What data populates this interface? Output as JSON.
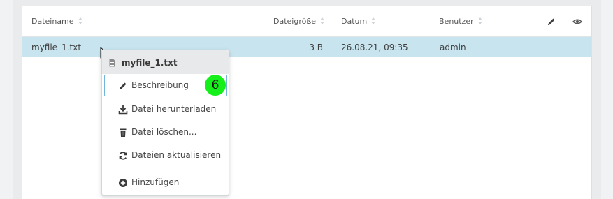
{
  "table": {
    "columns": {
      "filename": "Dateiname",
      "size": "Dateigröße",
      "date": "Datum",
      "user": "Benutzer"
    },
    "header_icons": [
      "pencil-icon",
      "eye-icon"
    ],
    "rows": [
      {
        "filename": "myfile_1.txt",
        "size": "3 B",
        "date": "26.08.21, 09:35",
        "user": "admin",
        "edit": "—",
        "view": "—"
      }
    ]
  },
  "context_menu": {
    "title": "myfile_1.txt",
    "title_icon": "file-text-icon",
    "items": [
      {
        "label": "Beschreibung",
        "icon": "pencil-icon"
      },
      {
        "label": "Datei herunterladen",
        "icon": "download-icon"
      },
      {
        "label": "Datei löschen...",
        "icon": "trash-icon"
      },
      {
        "label": "Dateien aktualisieren",
        "icon": "refresh-icon"
      },
      {
        "label": "Hinzufügen",
        "icon": "plus-circle-icon"
      }
    ]
  },
  "step_badge": "6",
  "colors": {
    "selected_row": "#c8e4ef",
    "active_item_border": "#6fb6d8",
    "step_badge": "#16f01a"
  }
}
